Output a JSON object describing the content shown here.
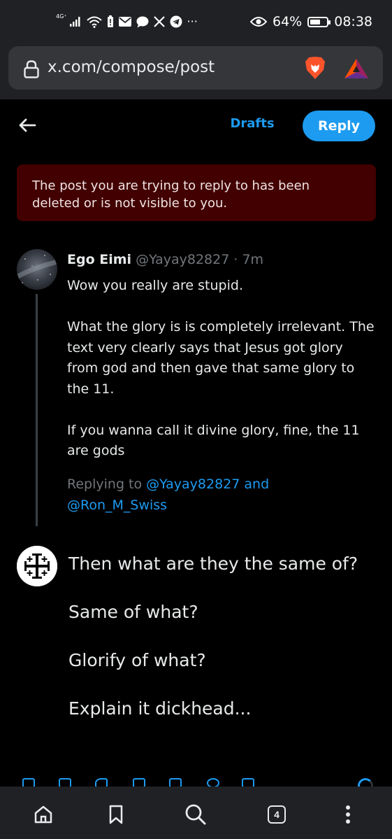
{
  "status_bar": {
    "network_label": "4G⁺",
    "overflow_glyph": "···",
    "battery_percent": "64%",
    "battery_level": 0.64,
    "time": "08:38",
    "icons": [
      "signal-icon",
      "wifi-icon",
      "battery-alert-icon",
      "mail-icon",
      "chat-icon",
      "x-logo-icon",
      "telegram-icon",
      "eye-icon",
      "battery-icon"
    ]
  },
  "browser": {
    "url": "x.com/compose/post",
    "icons": [
      "lock-icon",
      "brave-lion-icon",
      "bat-rewards-icon"
    ]
  },
  "compose_header": {
    "drafts_label": "Drafts",
    "reply_label": "Reply"
  },
  "notice": {
    "text": "The post you are trying to reply to has been deleted or is not visible to you.",
    "background": "#420000"
  },
  "parent_post": {
    "display_name": "Ego Eimi",
    "handle": "@Yayay82827",
    "separator": "·",
    "time": "7m",
    "paragraphs": [
      "Wow you really are stupid.",
      "What the glory is is completely irrelevant. The text very clearly says that Jesus got glory from god and then gave that same glory to the 11.",
      "If you wanna call it divine glory, fine, the 11 are gods"
    ],
    "replying_prefix": "Replying to ",
    "replying_user1": "@Yayay82827",
    "replying_and": " and",
    "replying_user2": "@Ron_M_Swiss"
  },
  "composer": {
    "lines": [
      "Then what are they the same of?",
      "Same of what?",
      "Glorify of what?",
      "Explain it dickhead..."
    ]
  },
  "bottom_nav": {
    "tab_count": "4",
    "icons": [
      "home-icon",
      "bookmark-icon",
      "search-icon",
      "tabs-icon",
      "more-vertical-icon"
    ]
  },
  "colors": {
    "accent": "#1d9bf0",
    "background": "#000000",
    "muted_text": "#71767b",
    "chrome": "#202124"
  }
}
